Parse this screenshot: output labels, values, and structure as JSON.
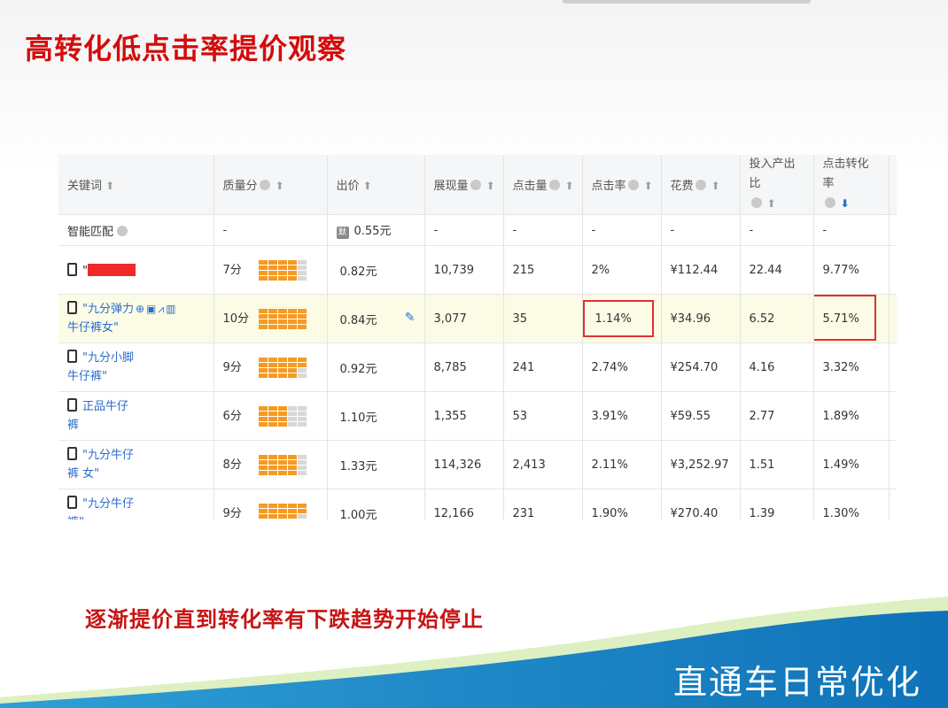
{
  "slide": {
    "title": "高转化低点击率提价观察",
    "note": "逐渐提价直到转化率有下跌趋势开始停止",
    "footer": "直通车日常优化"
  },
  "colors": {
    "title_red": "#d40c0c",
    "link_blue": "#2a6cc8",
    "quality_orange": "#f59a23",
    "footer_blue": "#1a86c9"
  },
  "table": {
    "headers": {
      "keyword": "关键词",
      "quality": "质量分",
      "bid": "出价",
      "impressions": "展现量",
      "clicks": "点击量",
      "ctr": "点击率",
      "cost": "花费",
      "roi_line1": "投入产出比",
      "cvr_line1": "点击转化率"
    },
    "smart_match": {
      "label": "智能匹配",
      "quality": "-",
      "bid_tag": "默",
      "bid": "0.55元",
      "impressions": "-",
      "clicks": "-",
      "ctr": "-",
      "cost": "-",
      "roi": "-",
      "cvr": "-"
    },
    "rows": [
      {
        "keyword": "\"",
        "score": "7分",
        "quality_level": 8,
        "bid": "0.82元",
        "impressions": "10,739",
        "clicks": "215",
        "ctr": "2%",
        "cost": "¥112.44",
        "roi": "22.44",
        "cvr": "9.77%"
      },
      {
        "keyword": "\"九分弹力",
        "keyword_line2": "牛仔裤女\"",
        "score": "10分",
        "quality_level": 10,
        "bid": "0.84元",
        "impressions": "3,077",
        "clicks": "35",
        "ctr": "1.14%",
        "cost": "¥34.96",
        "roi": "6.52",
        "cvr": "5.71%"
      },
      {
        "keyword": "\"九分小脚",
        "keyword_line2": "牛仔裤\"",
        "score": "9分",
        "quality_level": 9,
        "bid": "0.92元",
        "impressions": "8,785",
        "clicks": "241",
        "ctr": "2.74%",
        "cost": "¥254.70",
        "roi": "4.16",
        "cvr": "3.32%"
      },
      {
        "keyword": "正品牛仔",
        "keyword_line2": "裤",
        "score": "6分",
        "quality_level": 6,
        "bid": "1.10元",
        "impressions": "1,355",
        "clicks": "53",
        "ctr": "3.91%",
        "cost": "¥59.55",
        "roi": "2.77",
        "cvr": "1.89%"
      },
      {
        "keyword": "\"九分牛仔",
        "keyword_line2": "裤 女\"",
        "score": "8分",
        "quality_level": 8,
        "bid": "1.33元",
        "impressions": "114,326",
        "clicks": "2,413",
        "ctr": "2.11%",
        "cost": "¥3,252.97",
        "roi": "1.51",
        "cvr": "1.49%"
      },
      {
        "keyword": "\"九分牛仔",
        "keyword_line2": "裤\"",
        "score": "9分",
        "quality_level": 9,
        "bid": "1.00元",
        "impressions": "12,166",
        "clicks": "231",
        "ctr": "1.90%",
        "cost": "¥270.40",
        "roi": "1.39",
        "cvr": "1.30%"
      }
    ]
  }
}
